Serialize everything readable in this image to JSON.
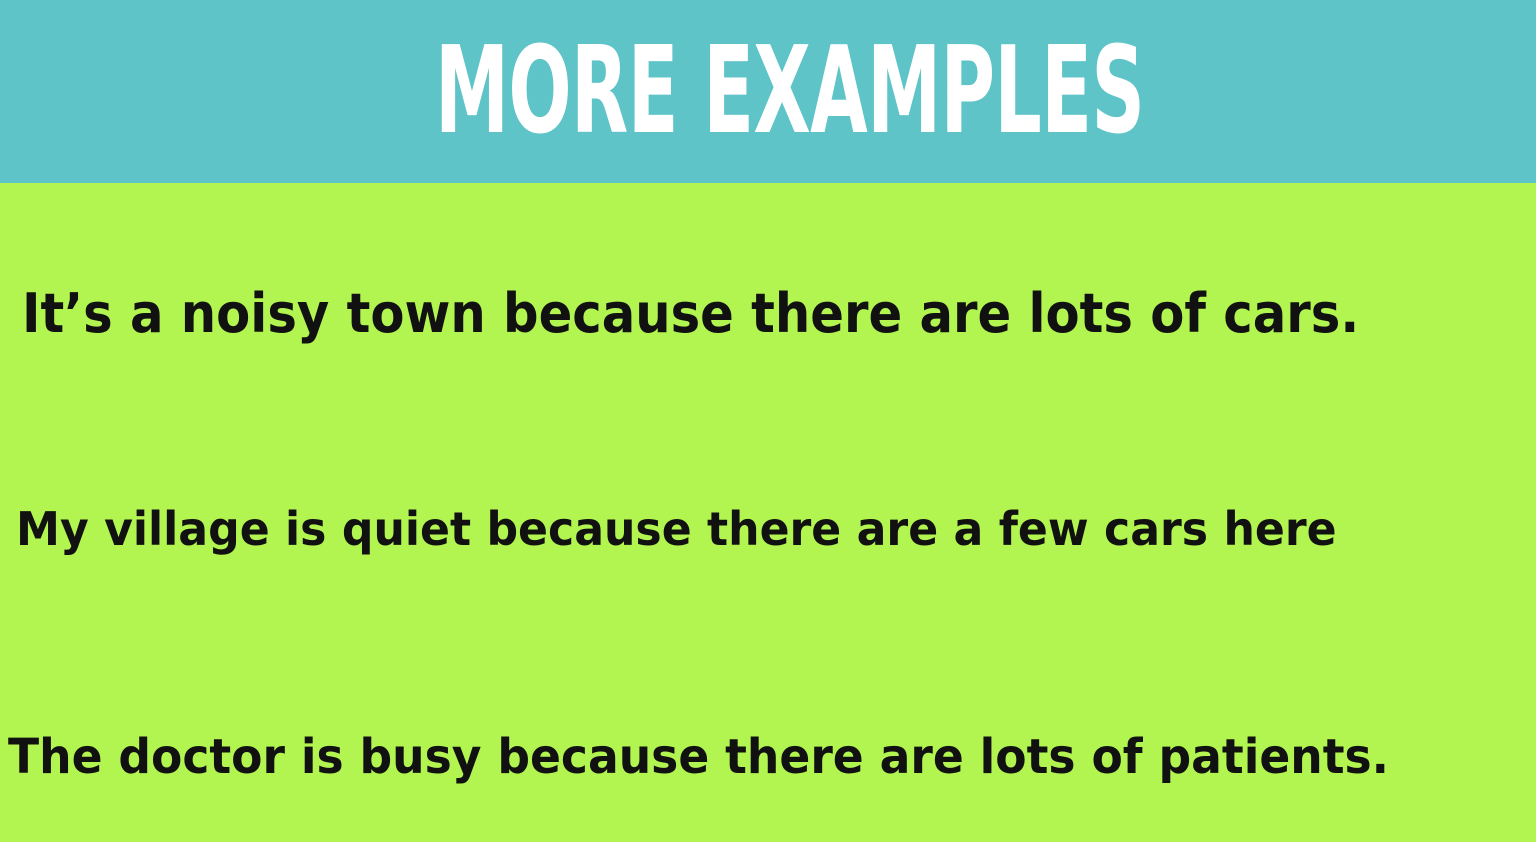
{
  "header": {
    "title": "MORE EXAMPLES"
  },
  "examples": [
    "It’s a noisy town because there are lots of cars.",
    "My village is quiet because there are a few cars here",
    "The doctor is busy because there are lots of patients."
  ],
  "colors": {
    "header_background": "#5ec4c8",
    "content_background": "#b2f550",
    "title_text": "#ffffff",
    "body_text": "#111111"
  }
}
